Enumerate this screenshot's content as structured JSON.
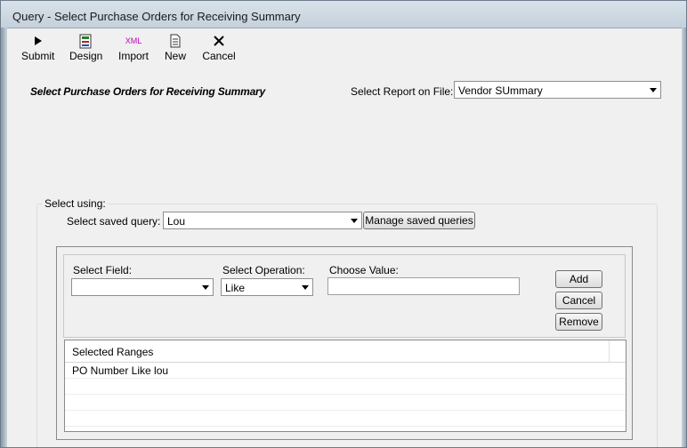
{
  "window": {
    "title": "Query - Select Purchase Orders for Receiving Summary"
  },
  "toolbar": {
    "submit": "Submit",
    "design": "Design",
    "import": "Import",
    "import_icon_text": "XML",
    "new": "New",
    "cancel": "Cancel"
  },
  "heading": "Select Purchase Orders for Receiving Summary",
  "report": {
    "label": "Select Report on File:",
    "value": "Vendor SUmmary"
  },
  "select_using": {
    "label": "Select using:",
    "saved_query_label": "Select saved query:",
    "saved_query_value": "Lou",
    "manage_button": "Manage saved queries"
  },
  "range_editor": {
    "field_label": "Select Field:",
    "field_value": "",
    "operation_label": "Select Operation:",
    "operation_value": "Like",
    "value_label": "Choose Value:",
    "value_input": "",
    "add_button": "Add",
    "cancel_button": "Cancel",
    "remove_button": "Remove"
  },
  "ranges_table": {
    "header": "Selected Ranges",
    "rows": [
      "PO Number Like lou",
      "",
      "",
      ""
    ]
  },
  "colors": {
    "title_bar": "#c4d0db",
    "window_bg": "#f0f0f0",
    "xml_icon": "#c000c0"
  }
}
